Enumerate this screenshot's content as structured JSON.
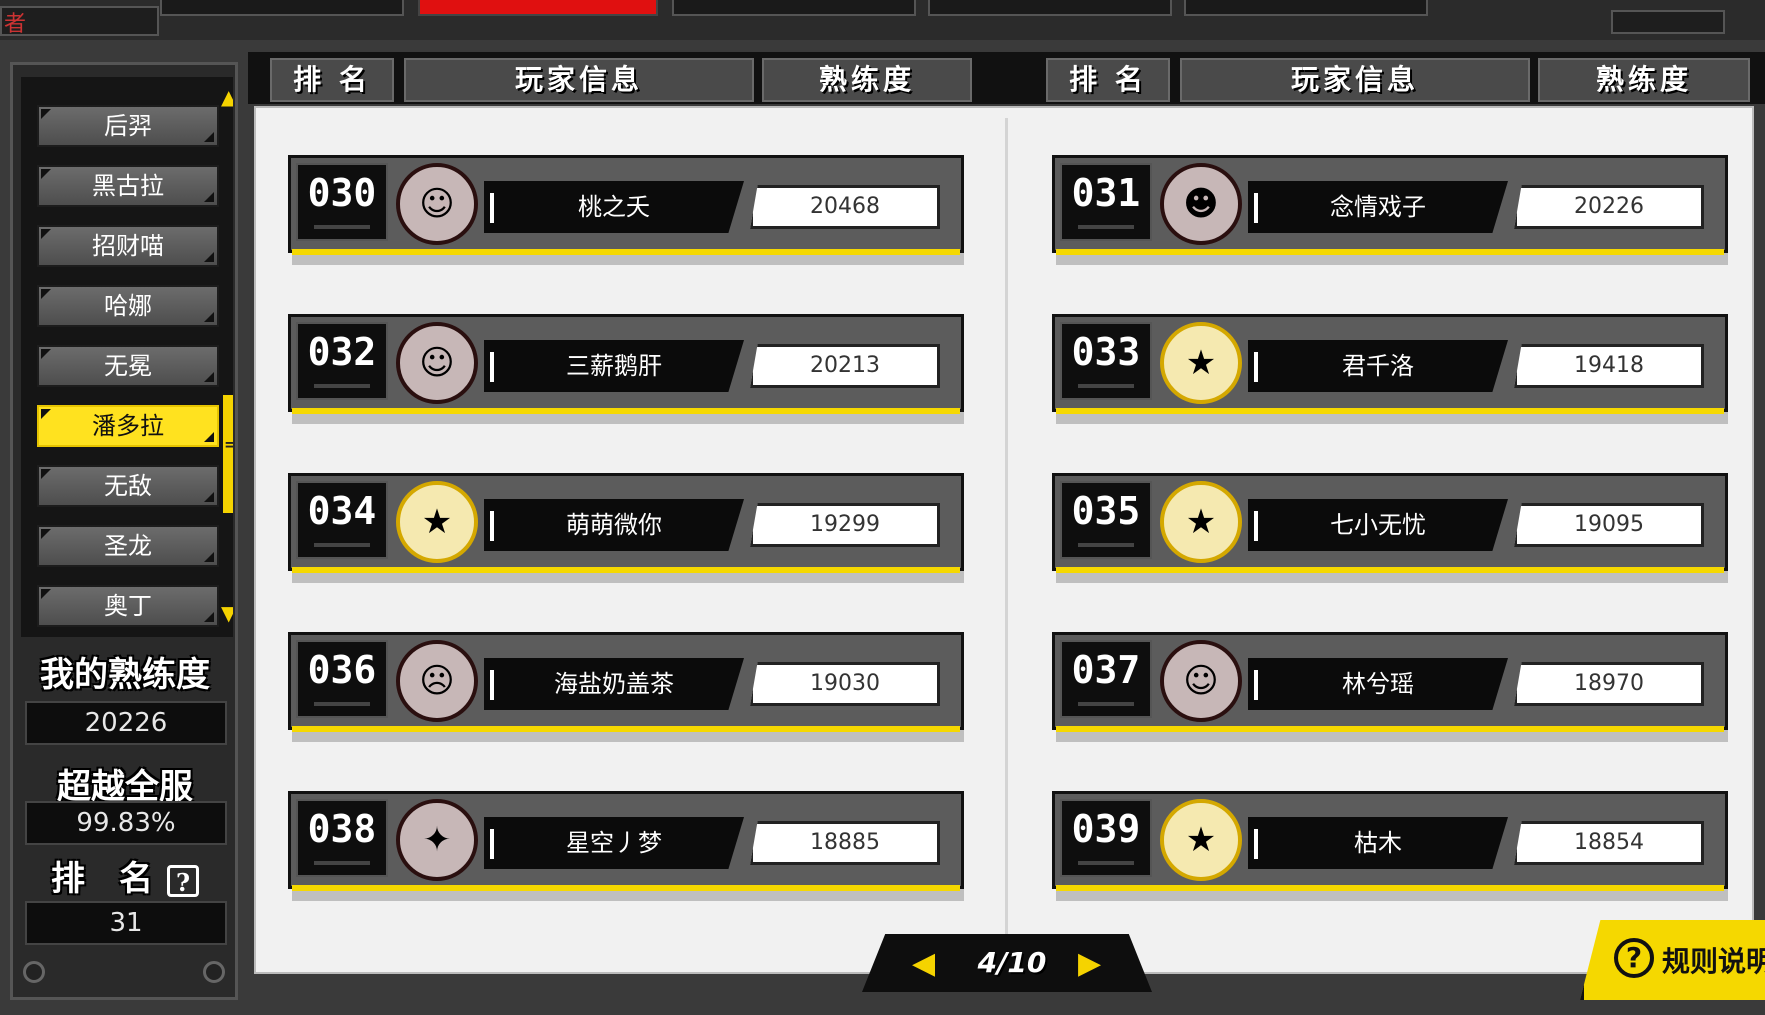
{
  "topbar": {
    "corner_label": "者"
  },
  "sidebar": {
    "heroes": [
      {
        "label": "后羿",
        "active": false
      },
      {
        "label": "黑古拉",
        "active": false
      },
      {
        "label": "招财喵",
        "active": false
      },
      {
        "label": "哈娜",
        "active": false
      },
      {
        "label": "无冕",
        "active": false
      },
      {
        "label": "潘多拉",
        "active": true
      },
      {
        "label": "无敌",
        "active": false
      },
      {
        "label": "圣龙",
        "active": false
      },
      {
        "label": "奥丁",
        "active": false
      }
    ],
    "my_proficiency_label": "我的熟练度",
    "my_proficiency_value": "20226",
    "beat_server_label": "超越全服",
    "beat_server_value": "99.83%",
    "rank_label": "排　名",
    "rank_help": "?",
    "rank_value": "31"
  },
  "header": {
    "rank": "排 名",
    "player": "玩家信息",
    "proficiency": "熟练度"
  },
  "leaderboard": [
    {
      "rank": "030",
      "name": "桃之夭",
      "score": "20468",
      "avatar_icon": "white-hair-hero-avatar",
      "gold": false
    },
    {
      "rank": "031",
      "name": "念情戏子",
      "score": "20226",
      "avatar_icon": "cat-hero-avatar",
      "gold": false
    },
    {
      "rank": "032",
      "name": "三薪鹅肝",
      "score": "20213",
      "avatar_icon": "white-hair-hero-avatar",
      "gold": false
    },
    {
      "rank": "033",
      "name": "君千洛",
      "score": "19418",
      "avatar_icon": "star-hero-avatar",
      "gold": true
    },
    {
      "rank": "034",
      "name": "萌萌微你",
      "score": "19299",
      "avatar_icon": "star-hero-avatar",
      "gold": true
    },
    {
      "rank": "035",
      "name": "七小无忧",
      "score": "19095",
      "avatar_icon": "star-hero-avatar",
      "gold": true
    },
    {
      "rank": "036",
      "name": "海盐奶盖茶",
      "score": "19030",
      "avatar_icon": "masked-hero-avatar",
      "gold": false
    },
    {
      "rank": "037",
      "name": "林兮瑶",
      "score": "18970",
      "avatar_icon": "fox-hero-avatar",
      "gold": false
    },
    {
      "rank": "038",
      "name": "星空丿梦",
      "score": "18885",
      "avatar_icon": "knight-hero-avatar",
      "gold": false
    },
    {
      "rank": "039",
      "name": "枯木",
      "score": "18854",
      "avatar_icon": "star-hero-avatar",
      "gold": true
    }
  ],
  "pager": {
    "text": "4/10"
  },
  "rules_button": {
    "label": "规则说明",
    "icon": "?"
  }
}
